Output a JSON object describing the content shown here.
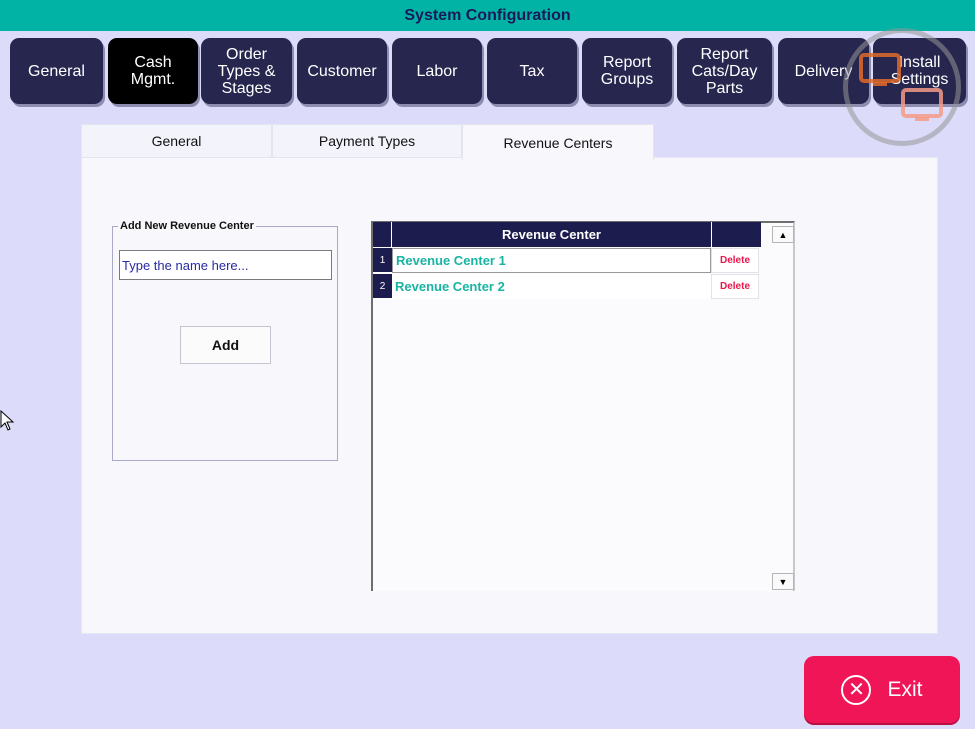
{
  "window": {
    "title": "System Configuration"
  },
  "main_tabs": [
    {
      "label": "General"
    },
    {
      "label": "Cash\nMgmt."
    },
    {
      "label": "Order\nTypes &\nStages"
    },
    {
      "label": "Customer"
    },
    {
      "label": "Labor"
    },
    {
      "label": "Tax"
    },
    {
      "label": "Report\nGroups"
    },
    {
      "label": "Report\nCats/Day\nParts"
    },
    {
      "label": "Delivery"
    },
    {
      "label": "Install\nSettings"
    }
  ],
  "active_main_tab": "Cash\nMgmt.",
  "sub_tabs": [
    {
      "label": "General"
    },
    {
      "label": "Payment Types"
    },
    {
      "label": "Revenue Centers"
    }
  ],
  "active_sub_tab": "Revenue Centers",
  "add_panel": {
    "legend": "Add New Revenue Center",
    "input_placeholder": "Type the name here...",
    "add_label": "Add"
  },
  "grid": {
    "column_header": "Revenue Center",
    "rows": [
      {
        "num": "1",
        "name": "Revenue Center 1",
        "delete_label": "Delete"
      },
      {
        "num": "2",
        "name": "Revenue Center 2",
        "delete_label": "Delete"
      }
    ]
  },
  "exit": {
    "label": "Exit"
  },
  "colors": {
    "title_bar": "#00b3a4",
    "tab_bg": "#26264f",
    "tab_active": "#000000",
    "accent_teal": "#1ab4a3",
    "delete_red": "#e8174c",
    "exit_bg": "#ef1557"
  }
}
